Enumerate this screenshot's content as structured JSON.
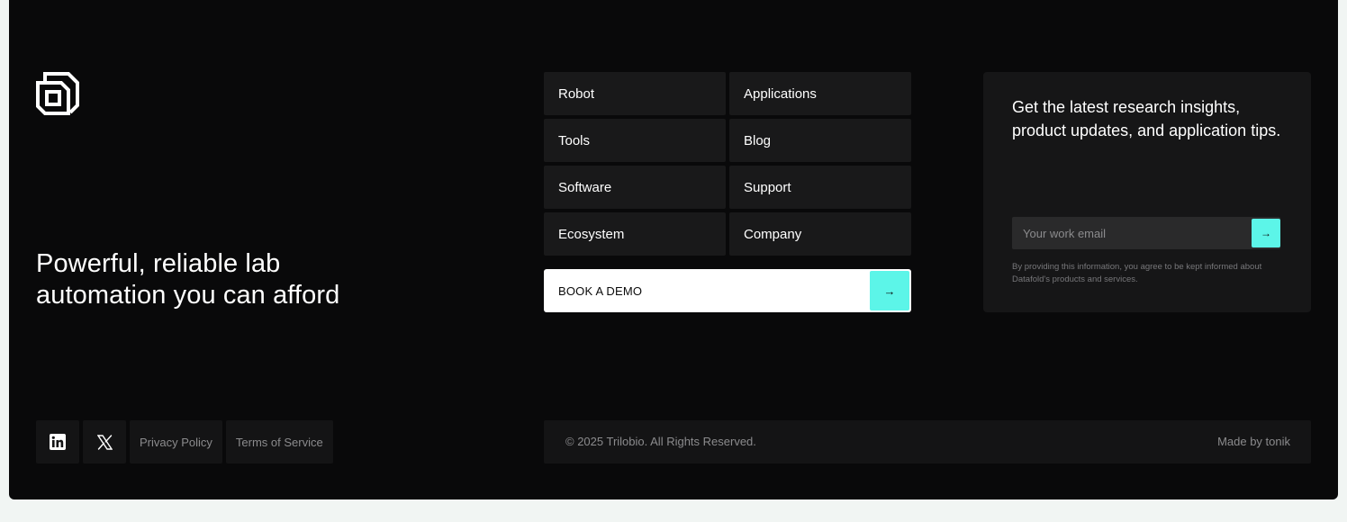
{
  "brand": {
    "logo_icon": "overlapping-squares-logo-icon",
    "tagline": "Powerful, reliable lab automation you can afford"
  },
  "nav": {
    "items": [
      {
        "label": "Robot"
      },
      {
        "label": "Applications"
      },
      {
        "label": "Tools"
      },
      {
        "label": "Blog"
      },
      {
        "label": "Software"
      },
      {
        "label": "Support"
      },
      {
        "label": "Ecosystem"
      },
      {
        "label": "Company"
      }
    ]
  },
  "cta": {
    "label": "BOOK A DEMO",
    "arrow": "→",
    "accent_color": "#5cf5e8"
  },
  "newsletter": {
    "heading": "Get the latest research insights, product updates, and application tips.",
    "email_placeholder": "Your work email",
    "submit_arrow": "→",
    "disclaimer": "By providing this information, you agree to be kept informed about Datafold's products and services."
  },
  "social": {
    "linkedin_icon": "linkedin-icon",
    "x_icon": "x-twitter-icon"
  },
  "legal": {
    "privacy": "Privacy Policy",
    "terms": "Terms of Service"
  },
  "bottom_bar": {
    "copyright": "© 2025 Trilobio. All Rights Reserved.",
    "made_by": "Made by tonik"
  },
  "colors": {
    "background": "#09090a",
    "panel": "#19191a",
    "accent": "#5cf5e8",
    "page_bg": "#f1f5f3"
  }
}
